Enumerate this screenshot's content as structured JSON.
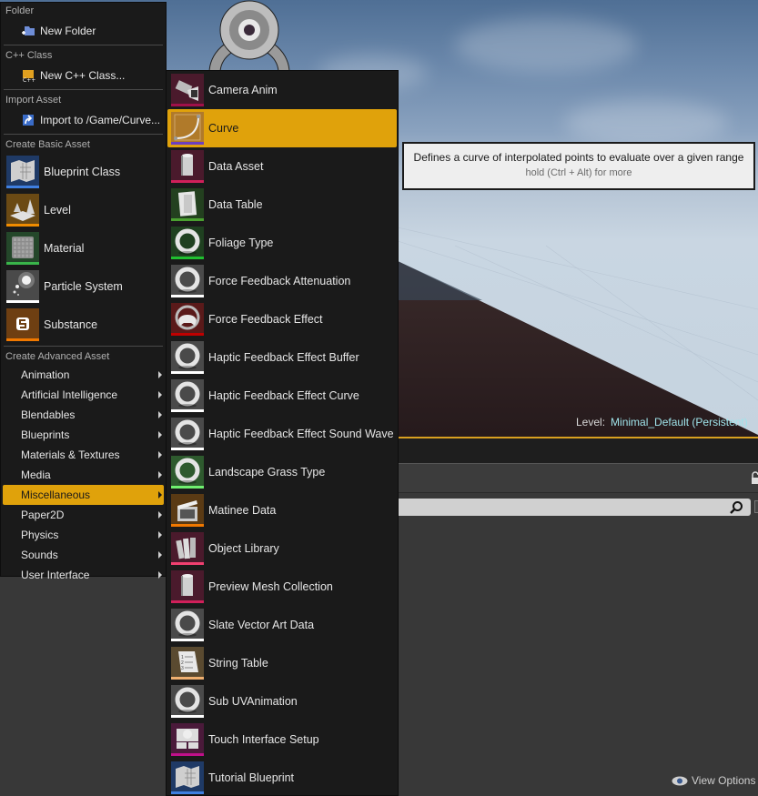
{
  "main_menu": {
    "sections": {
      "folder": {
        "header": "Folder",
        "items": [
          {
            "label": "New Folder",
            "icon": "new-folder-icon"
          }
        ]
      },
      "cpp_class": {
        "header": "C++ Class",
        "items": [
          {
            "label": "New C++ Class...",
            "icon": "cpp-class-icon"
          }
        ]
      },
      "import_asset": {
        "header": "Import Asset",
        "items": [
          {
            "label": "Import to /Game/Curve...",
            "icon": "import-icon"
          }
        ]
      },
      "basic_asset": {
        "header": "Create Basic Asset",
        "items": [
          {
            "label": "Blueprint Class",
            "icon": "blueprint-icon",
            "bg": "#1f3a66",
            "bar": "#3f7fe0"
          },
          {
            "label": "Level",
            "icon": "level-icon",
            "bg": "#6b4a14",
            "bar": "#f08c00"
          },
          {
            "label": "Material",
            "icon": "material-icon",
            "bg": "#24472a",
            "bar": "#39b54a"
          },
          {
            "label": "Particle System",
            "icon": "particle-system-icon",
            "bg": "#4a4a4a",
            "bar": "#ffffff"
          },
          {
            "label": "Substance",
            "icon": "substance-icon",
            "bg": "#6e3f12",
            "bar": "#f07800"
          }
        ]
      },
      "advanced_asset": {
        "header": "Create Advanced Asset",
        "items": [
          {
            "label": "Animation",
            "selected": false
          },
          {
            "label": "Artificial Intelligence",
            "selected": false
          },
          {
            "label": "Blendables",
            "selected": false
          },
          {
            "label": "Blueprints",
            "selected": false
          },
          {
            "label": "Materials & Textures",
            "selected": false
          },
          {
            "label": "Media",
            "selected": false
          },
          {
            "label": "Miscellaneous",
            "selected": true
          },
          {
            "label": "Paper2D",
            "selected": false
          },
          {
            "label": "Physics",
            "selected": false
          },
          {
            "label": "Sounds",
            "selected": false
          },
          {
            "label": "User Interface",
            "selected": false
          }
        ]
      }
    }
  },
  "submenu": {
    "items": [
      {
        "label": "Camera Anim",
        "icon": "camera-anim-icon",
        "bg": "#4a1a2c",
        "bar": "#a0104a",
        "selected": false
      },
      {
        "label": "Curve",
        "icon": "curve-icon",
        "bg": "#b07a2a",
        "bar": "#6b3fc0",
        "selected": true
      },
      {
        "label": "Data Asset",
        "icon": "data-asset-icon",
        "bg": "#4a1a2c",
        "bar": "#d0205a",
        "selected": false
      },
      {
        "label": "Data Table",
        "icon": "data-table-icon",
        "bg": "#23401f",
        "bar": "#4aa030",
        "selected": false
      },
      {
        "label": "Foliage Type",
        "icon": "foliage-type-icon",
        "bg": "#1f4020",
        "bar": "#20c030",
        "selected": false
      },
      {
        "label": "Force Feedback Attenuation",
        "icon": "force-feedback-attenuation-icon",
        "bg": "#4a4a4a",
        "bar": "#ffffff",
        "selected": false
      },
      {
        "label": "Force Feedback Effect",
        "icon": "force-feedback-effect-icon",
        "bg": "#5a1a1a",
        "bar": "#c00000",
        "selected": false
      },
      {
        "label": "Haptic Feedback Effect Buffer",
        "icon": "haptic-buffer-icon",
        "bg": "#4a4a4a",
        "bar": "#ffffff",
        "selected": false
      },
      {
        "label": "Haptic Feedback Effect Curve",
        "icon": "haptic-curve-icon",
        "bg": "#4a4a4a",
        "bar": "#ffffff",
        "selected": false
      },
      {
        "label": "Haptic Feedback Effect Sound Wave",
        "icon": "haptic-sound-wave-icon",
        "bg": "#4a4a4a",
        "bar": "#ffffff",
        "selected": false
      },
      {
        "label": "Landscape Grass Type",
        "icon": "landscape-grass-type-icon",
        "bg": "#2e5a2e",
        "bar": "#70f070",
        "selected": false
      },
      {
        "label": "Matinee Data",
        "icon": "matinee-data-icon",
        "bg": "#5a3a14",
        "bar": "#f07800",
        "selected": false
      },
      {
        "label": "Object Library",
        "icon": "object-library-icon",
        "bg": "#4a1a2c",
        "bar": "#f04070",
        "selected": false
      },
      {
        "label": "Preview Mesh Collection",
        "icon": "preview-mesh-collection-icon",
        "bg": "#4a1a2c",
        "bar": "#d0205a",
        "selected": false
      },
      {
        "label": "Slate Vector Art Data",
        "icon": "slate-vector-art-icon",
        "bg": "#4a4a4a",
        "bar": "#ffffff",
        "selected": false
      },
      {
        "label": "String Table",
        "icon": "string-table-icon",
        "bg": "#5a4a30",
        "bar": "#f0b070",
        "selected": false
      },
      {
        "label": "Sub UVAnimation",
        "icon": "sub-uv-animation-icon",
        "bg": "#4a4a4a",
        "bar": "#ffffff",
        "selected": false
      },
      {
        "label": "Touch Interface Setup",
        "icon": "touch-interface-icon",
        "bg": "#4a1a3a",
        "bar": "#c0108a",
        "selected": false
      },
      {
        "label": "Tutorial Blueprint",
        "icon": "tutorial-blueprint-icon",
        "bg": "#1f3a66",
        "bar": "#3f7fe0",
        "selected": false
      }
    ]
  },
  "tooltip": {
    "text": "Defines a curve of interpolated points to evaluate over a given range",
    "hint": "hold (Ctrl + Alt) for more"
  },
  "viewport": {
    "level_prefix": "Level:",
    "level_name": "Minimal_Default (Persistent)"
  },
  "content_browser": {
    "view_options_label": "View Options"
  },
  "colors": {
    "accent": "#e0a20b",
    "menu_bg": "#1a1a1a",
    "level_name": "#9fe3ea"
  }
}
